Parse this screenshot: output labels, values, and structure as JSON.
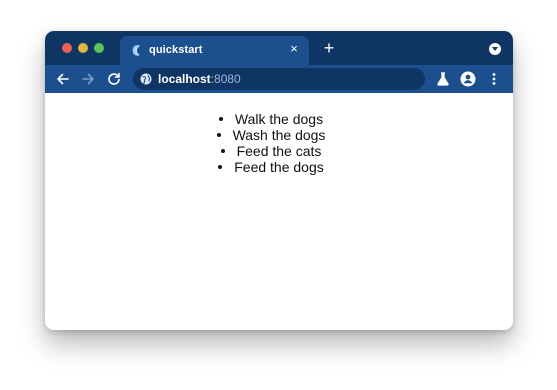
{
  "browser": {
    "tab": {
      "title": "quickstart",
      "close_label": "×"
    },
    "new_tab_label": "+",
    "address": {
      "host": "localhost",
      "port": ":8080"
    }
  },
  "page": {
    "items": [
      "Walk the dogs",
      "Wash the dogs",
      "Feed the cats",
      "Feed the dogs"
    ]
  },
  "colors": {
    "tabstrip": "#0f3564",
    "toolbar": "#1c4f8e",
    "close": "#ec5f58",
    "minimize": "#e1b53e",
    "maximize": "#5ec45a"
  }
}
